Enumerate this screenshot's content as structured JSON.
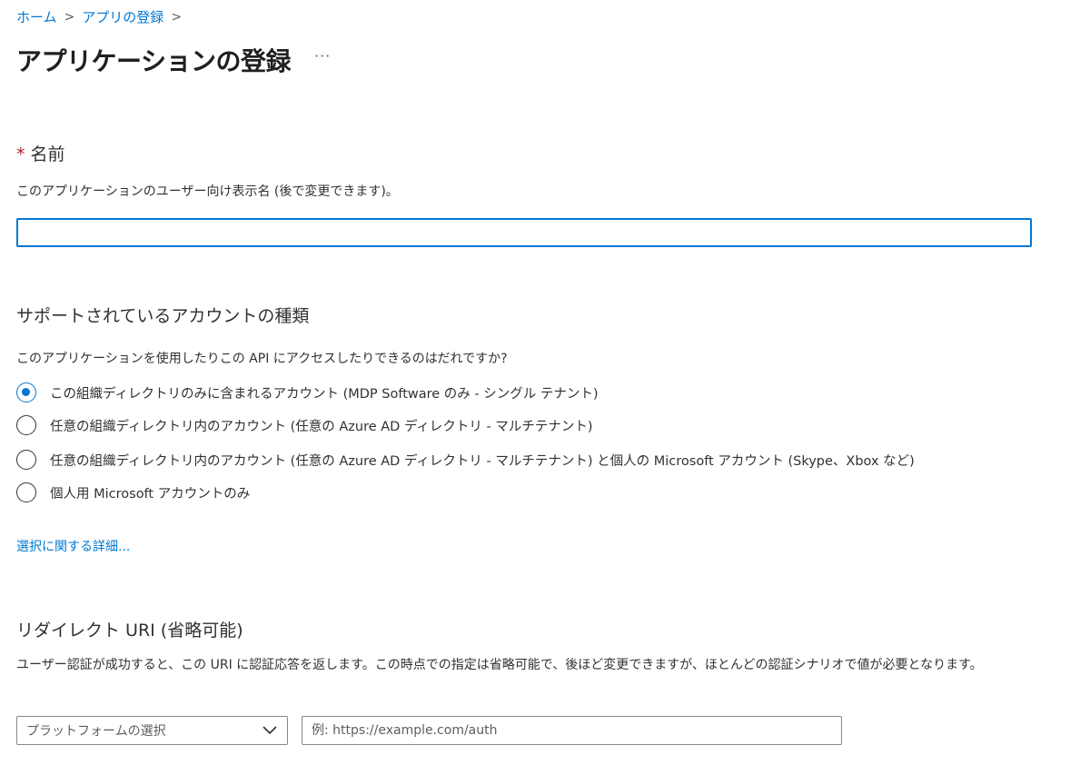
{
  "breadcrumb": {
    "items": [
      "ホーム",
      "アプリの登録"
    ],
    "separator": ">"
  },
  "page": {
    "title": "アプリケーションの登録",
    "more_label": "···"
  },
  "name_section": {
    "required_mark": "*",
    "title": "名前",
    "description": "このアプリケーションのユーザー向け表示名 (後で変更できます)。",
    "input_value": ""
  },
  "account_section": {
    "title": "サポートされているアカウントの種類",
    "question": "このアプリケーションを使用したりこの API にアクセスしたりできるのはだれですか?",
    "options": [
      {
        "label": "この組織ディレクトリのみに含まれるアカウント (MDP Software のみ - シングル テナント)",
        "selected": true
      },
      {
        "label": "任意の組織ディレクトリ内のアカウント (任意の Azure AD ディレクトリ - マルチテナント)",
        "selected": false
      },
      {
        "label": "任意の組織ディレクトリ内のアカウント (任意の Azure AD ディレクトリ - マルチテナント) と個人の Microsoft アカウント (Skype、Xbox など)",
        "selected": false
      },
      {
        "label": "個人用 Microsoft アカウントのみ",
        "selected": false
      }
    ],
    "details_link": "選択に関する詳細..."
  },
  "redirect_section": {
    "title": "リダイレクト URI (省略可能)",
    "description": "ユーザー認証が成功すると、この URI に認証応答を返します。この時点での指定は省略可能で、後ほど変更できますが、ほとんどの認証シナリオで値が必要となります。",
    "platform_placeholder": "プラットフォームの選択",
    "uri_placeholder": "例: https://example.com/auth"
  },
  "colors": {
    "accent": "#0078d4",
    "required": "#a4262c",
    "text": "#323130"
  }
}
